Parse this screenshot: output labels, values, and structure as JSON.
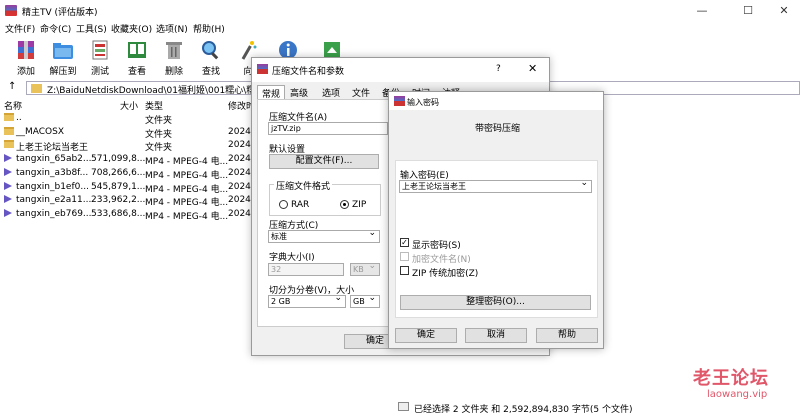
{
  "window": {
    "title": "精主TV (评估版本)",
    "minimize": "—",
    "maximize": "☐",
    "close": "✕"
  },
  "menu": [
    "文件(F)",
    "命令(C)",
    "工具(S)",
    "收藏夹(O)",
    "选项(N)",
    "帮助(H)"
  ],
  "toolbar": [
    {
      "label": "添加",
      "icon": "add-archive-icon"
    },
    {
      "label": "解压到",
      "icon": "extract-folder-icon"
    },
    {
      "label": "测试",
      "icon": "test-icon"
    },
    {
      "label": "查看",
      "icon": "view-book-icon"
    },
    {
      "label": "删除",
      "icon": "trash-icon"
    },
    {
      "label": "查找",
      "icon": "magnifier-icon"
    },
    {
      "label": "向",
      "icon": "wizard-icon"
    },
    {
      "label": "",
      "icon": "info-icon"
    },
    {
      "label": "",
      "icon": "sfx-icon"
    }
  ],
  "address": {
    "path": "Z:\\BaiduNetdiskDownload\\01福利姬\\001糯心\\糯主T"
  },
  "columns": {
    "name": "名称",
    "size": "大小",
    "type": "类型",
    "modified": "修改时"
  },
  "files": [
    {
      "name": "..",
      "size": "",
      "type": "文件夹",
      "date": "",
      "icon": "folder"
    },
    {
      "name": "__MACOSX",
      "size": "",
      "type": "文件夹",
      "date": "2024/",
      "icon": "folder"
    },
    {
      "name": "上老王论坛当老王",
      "size": "",
      "type": "文件夹",
      "date": "2024/",
      "icon": "folder"
    },
    {
      "name": "tangxin_65ab2...",
      "size": "571,099,8...",
      "type": "MP4 - MPEG-4 电...",
      "date": "2024/",
      "icon": "video"
    },
    {
      "name": "tangxin_a3b8f...",
      "size": "708,266,6...",
      "type": "MP4 - MPEG-4 电...",
      "date": "2024/",
      "icon": "video"
    },
    {
      "name": "tangxin_b1ef0...",
      "size": "545,879,1...",
      "type": "MP4 - MPEG-4 电...",
      "date": "2024/",
      "icon": "video"
    },
    {
      "name": "tangxin_e2a11...",
      "size": "233,962,2...",
      "type": "MP4 - MPEG-4 电...",
      "date": "2024/",
      "icon": "video"
    },
    {
      "name": "tangxin_eb769...",
      "size": "533,686,8...",
      "type": "MP4 - MPEG-4 电...",
      "date": "2024/",
      "icon": "video"
    }
  ],
  "status": "已经选择 2 文件夹 和 2,592,894,830 字节(5 个文件)",
  "watermark": {
    "text": "老王论坛",
    "url": "laowang.vip"
  },
  "archive_dialog": {
    "title": "压缩文件名和参数",
    "help": "?",
    "tabs": [
      "常规",
      "高级",
      "选项",
      "文件",
      "备份",
      "时间",
      "注释"
    ],
    "archive_name_label": "压缩文件名(A)",
    "archive_name": "jzTV.zip",
    "profiles_label": "默认设置",
    "profiles_button": "配置文件(F)...",
    "format_label": "压缩文件格式",
    "format_rar": "RAR",
    "format_zip": "ZIP",
    "method_label": "压缩方式(C)",
    "method_value": "标准",
    "dict_label": "字典大小(I)",
    "dict_value": "32",
    "dict_unit": "KB",
    "split_label": "切分为分卷(V)，大小",
    "split_value": "2 GB",
    "split_unit": "GB",
    "ok": "确定"
  },
  "password_dialog": {
    "title": "输入密码",
    "heading": "带密码压缩",
    "enter_label": "输入密码(E)",
    "password_value": "上老王论坛当老王",
    "show_password": "显示密码(S)",
    "show_password_checked": true,
    "encrypt_names": "加密文件名(N)",
    "zip_legacy": "ZIP 传统加密(Z)",
    "organize_button": "整理密码(O)...",
    "ok": "确定",
    "cancel": "取消",
    "help": "帮助"
  }
}
